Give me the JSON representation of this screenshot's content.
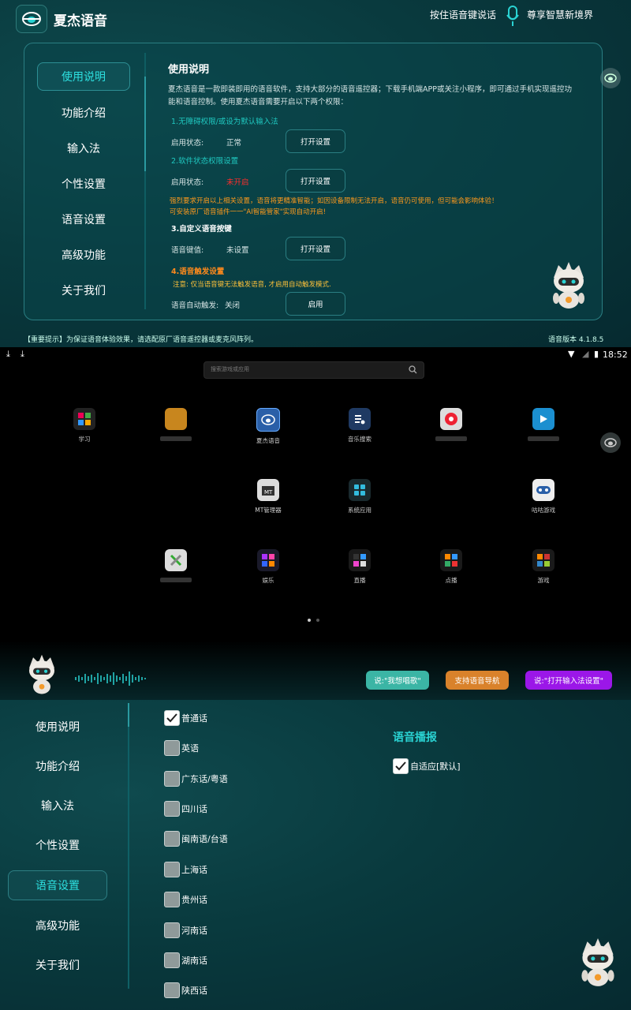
{
  "top": {
    "app_name": "夏杰语音",
    "hold_hint": "按住语音键说话",
    "slogan": "尊享智慧新境界",
    "nav": [
      "使用说明",
      "功能介绍",
      "输入法",
      "个性设置",
      "语音设置",
      "高级功能",
      "关于我们"
    ],
    "heading": "使用说明",
    "description": "夏杰语音是一款即装即用的语音软件，支持大部分的语音遥控器；下载手机端APP或关注小程序，即可通过手机实现遥控功能和语音控制。使用夏杰语音需要开启以下两个权限：",
    "s1_title": "1.无障碍权限/或设为默认输入法",
    "s1_label": "启用状态:",
    "s1_value": "正常",
    "s1_button": "打开设置",
    "s2_title": "2.软件状态权限设置",
    "s2_label": "启用状态:",
    "s2_value": "未开启",
    "s2_button": "打开设置",
    "warning": "强烈要求开启以上相关设置，语音将更精准智能；如因设备限制无法开启，语音仍可使用，但可能会影响体验！",
    "warning2": "可安装原厂语音插件一一\"AI智能管家\"实现自动开启!",
    "s3_title": "3.自定义语音按键",
    "s3_label": "语音键值:",
    "s3_value": "未设置",
    "s3_button": "打开设置",
    "s4_title": "4.语音触发设置",
    "s4_note": "注意: 仅当语音键无法触发语音, 才启用自动触发模式.",
    "s4_label": "语音自动触发:",
    "s4_value": "关闭",
    "s4_button": "启用",
    "footer_hint": "【重要提示】为保证语音体验效果，请选配原厂语音遥控器或麦克风阵列。",
    "version": "语音版本 4.1.8.5"
  },
  "launcher": {
    "time": "18:52",
    "search_placeholder": "搜索游戏或应用",
    "apps_row1": [
      "学习",
      "",
      "夏杰语音",
      "音乐搜索",
      "",
      ""
    ],
    "apps_row2": [
      "MT管理器",
      "系统应用",
      "咕咕游戏"
    ],
    "apps_row3": [
      "",
      "娱乐",
      "直播",
      "点播",
      "游戏"
    ],
    "chip1": "说:\"我想唱歌\"",
    "chip2": "支持语音导航",
    "chip3": "说:\"打开输入法设置\"",
    "colors": {
      "chip1": "#3bb5a5",
      "chip2": "#d9822b",
      "chip3": "#9b17e8"
    }
  },
  "bottom": {
    "nav": [
      "使用说明",
      "功能介绍",
      "输入法",
      "个性设置",
      "语音设置",
      "高级功能",
      "关于我们"
    ],
    "languages": [
      {
        "label": "普通话",
        "checked": true
      },
      {
        "label": "英语",
        "checked": false
      },
      {
        "label": "广东话/粤语",
        "checked": false
      },
      {
        "label": "四川话",
        "checked": false
      },
      {
        "label": "闽南语/台语",
        "checked": false
      },
      {
        "label": "上海话",
        "checked": false
      },
      {
        "label": "贵州话",
        "checked": false
      },
      {
        "label": "河南话",
        "checked": false
      },
      {
        "label": "湖南话",
        "checked": false
      },
      {
        "label": "陕西话",
        "checked": false
      }
    ],
    "broadcast_title": "语音播报",
    "broadcast_option": "自适应[默认]"
  }
}
